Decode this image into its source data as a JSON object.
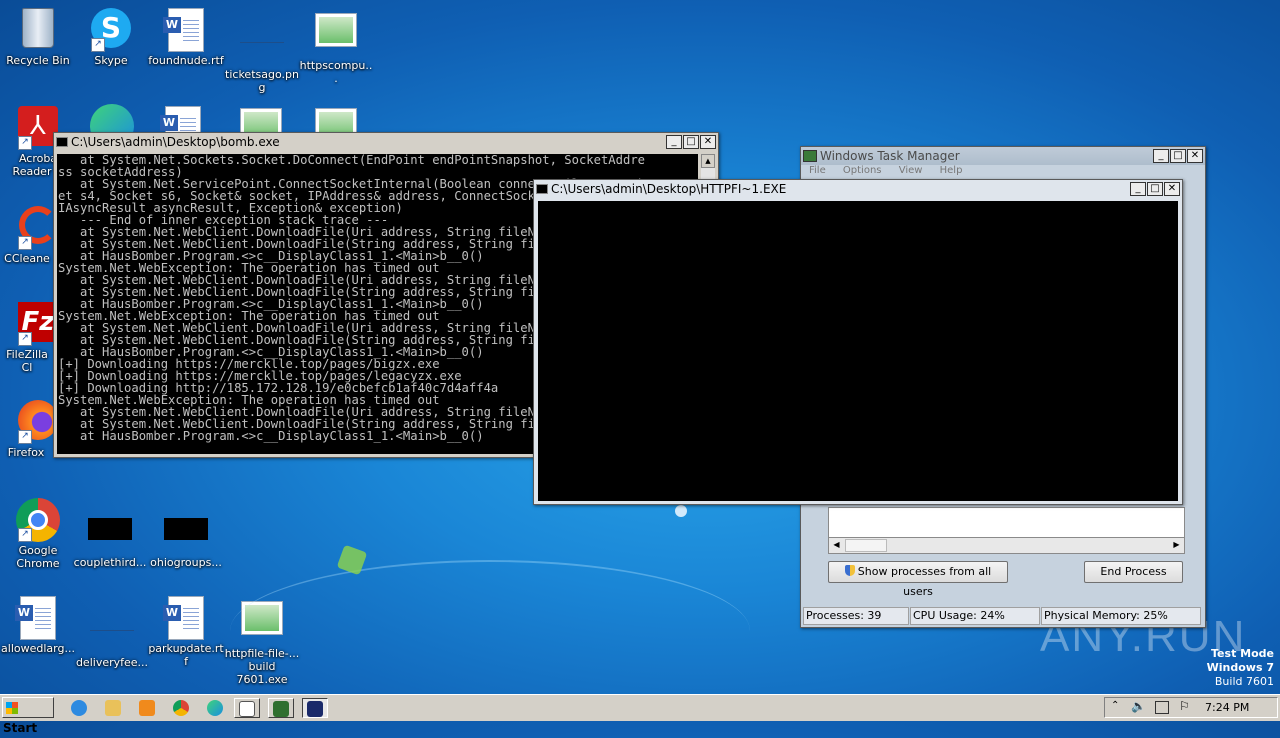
{
  "desktop": {
    "icons": [
      {
        "label": "Recycle Bin"
      },
      {
        "label": "Skype"
      },
      {
        "label": "foundnude.rtf"
      },
      {
        "label": "ticketsago.png"
      },
      {
        "label": "httpscompu..."
      },
      {
        "label": "Acroba Reader D"
      },
      {
        "label": "CCleane"
      },
      {
        "label": "FileZilla Cl"
      },
      {
        "label": "Firefox"
      },
      {
        "label": "Google Chrome"
      },
      {
        "label": "couplethird..."
      },
      {
        "label": "ohiogroups..."
      },
      {
        "label": "allowedlarg..."
      },
      {
        "label": "deliveryfee..."
      },
      {
        "label": "parkupdate.rtf"
      },
      {
        "label": "httpfile-file-...\nbuild 7601.exe"
      }
    ],
    "watermark": "ANY.RUN",
    "os_notice": {
      "line1": "Test Mode",
      "line2": "Windows 7",
      "line3": "Build 7601"
    }
  },
  "bomb_window": {
    "title": "C:\\Users\\admin\\Desktop\\bomb.exe",
    "lines": [
      "   at System.Net.Sockets.Socket.DoConnect(EndPoint endPointSnapshot, SocketAddre",
      "ss socketAddress)",
      "   at System.Net.ServicePoint.ConnectSocketInternal(Boolean connectFailure, Sock",
      "et s4, Socket s6, Socket& socket, IPAddress& address, ConnectSocketState state,",
      "IAsyncResult asyncResult, Exception& exception)",
      "   --- End of inner exception stack trace ---",
      "   at System.Net.WebClient.DownloadFile(Uri address, String fileName)",
      "   at System.Net.WebClient.DownloadFile(String address, String fileName)",
      "   at HausBomber.Program.<>c__DisplayClass1_1.<Main>b__0()",
      "System.Net.WebException: The operation has timed out",
      "   at System.Net.WebClient.DownloadFile(Uri address, String fileName)",
      "   at System.Net.WebClient.DownloadFile(String address, String fileName)",
      "   at HausBomber.Program.<>c__DisplayClass1_1.<Main>b__0()",
      "System.Net.WebException: The operation has timed out",
      "   at System.Net.WebClient.DownloadFile(Uri address, String fileName)",
      "   at System.Net.WebClient.DownloadFile(String address, String fileName)",
      "   at HausBomber.Program.<>c__DisplayClass1_1.<Main>b__0()",
      "[+] Downloading https://mercklle.top/pages/bigzx.exe",
      "[+] Downloading https://mercklle.top/pages/legacyzx.exe",
      "[+] Downloading http://185.172.128.19/e0cbefcb1af40c7d4aff4a",
      "System.Net.WebException: The operation has timed out",
      "   at System.Net.WebClient.DownloadFile(Uri address, String fileName)",
      "   at System.Net.WebClient.DownloadFile(String address, String fileName)",
      "   at HausBomber.Program.<>c__DisplayClass1_1.<Main>b__0()"
    ]
  },
  "httpfi_window": {
    "title": "C:\\Users\\admin\\Desktop\\HTTPFI~1.EXE"
  },
  "task_manager": {
    "title": "Windows Task Manager",
    "menu": [
      "File",
      "Options",
      "View",
      "Help"
    ],
    "show_all_label": "Show processes from all users",
    "end_process_label": "End Process",
    "status": {
      "processes": "Processes: 39",
      "cpu": "CPU Usage: 24%",
      "memory": "Physical Memory: 25%"
    }
  },
  "taskbar": {
    "start_label": "Start",
    "clock": "7:24 PM"
  }
}
